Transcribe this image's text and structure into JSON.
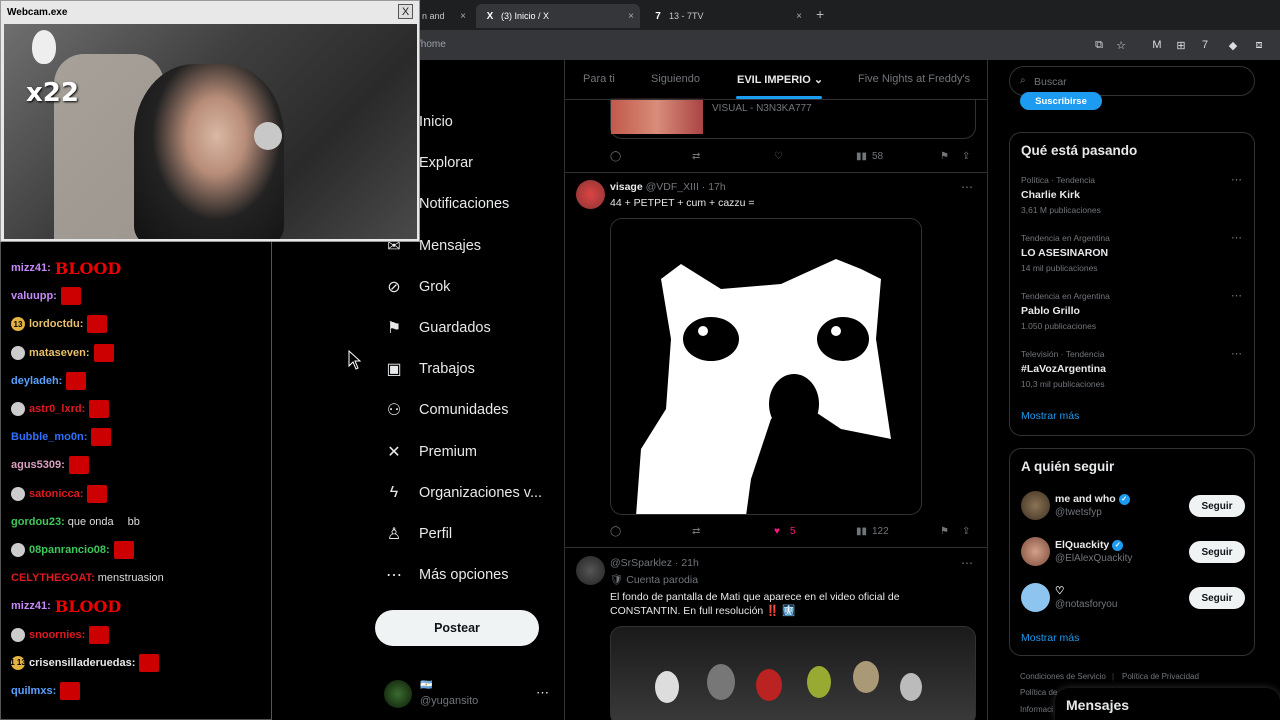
{
  "browser": {
    "tabs": [
      {
        "label": "n and",
        "fav": ""
      },
      {
        "label": "(3) Inicio / X",
        "fav": "X"
      },
      {
        "label": "13 - 7TV",
        "fav": "7"
      }
    ],
    "url": "/home",
    "new_tab": "+",
    "close": "×"
  },
  "webcam": {
    "title": "Webcam.exe",
    "close": "X",
    "overlay_text": "x22"
  },
  "chat": [
    {
      "user": "mizz41:",
      "color": "#c58af9",
      "msg": "",
      "emote": "BLOOD",
      "badge": ""
    },
    {
      "user": "valuupp:",
      "color": "#c58af9",
      "msg": "",
      "emote": "red",
      "badge": ""
    },
    {
      "user": "lordoctdu:",
      "color": "#e8c06a",
      "msg": "",
      "emote": "red",
      "badge": "13"
    },
    {
      "user": "mataseven:",
      "color": "#e8c06a",
      "msg": "",
      "emote": "red",
      "badge": "skull"
    },
    {
      "user": "deyladeh:",
      "color": "#5aa0ff",
      "msg": "",
      "emote": "red",
      "badge": ""
    },
    {
      "user": "astr0_lxrd:",
      "color": "#e0191f",
      "msg": "",
      "emote": "red",
      "badge": "skull"
    },
    {
      "user": "Bubble_mo0n:",
      "color": "#2f6fff",
      "msg": "",
      "emote": "red",
      "badge": ""
    },
    {
      "user": "agus5309:",
      "color": "#d9a0c0",
      "msg": "",
      "emote": "red",
      "badge": ""
    },
    {
      "user": "satonicca:",
      "color": "#e0191f",
      "msg": "",
      "emote": "red",
      "badge": "skull"
    },
    {
      "user": "gordou23:",
      "color": "#3dc85a",
      "msg": "que onda",
      "emote": "",
      "badge": "",
      "msg2": "bb"
    },
    {
      "user": "08panrancio08:",
      "color": "#3dc85a",
      "msg": "",
      "emote": "red",
      "badge": "skull"
    },
    {
      "user": "CELYTHEGOAT:",
      "color": "#e0191f",
      "msg": "menstruasion",
      "emote": "",
      "badge": ""
    },
    {
      "user": "mizz41:",
      "color": "#c58af9",
      "msg": "",
      "emote": "BLOOD",
      "badge": ""
    },
    {
      "user": "snoornies:",
      "color": "#e0191f",
      "msg": "",
      "emote": "red",
      "badge": "skull"
    },
    {
      "user": "crisensilladeruedas:",
      "color": "#e7e9ea",
      "msg": "",
      "emote": "red",
      "badge": "1 13"
    },
    {
      "user": "quilmxs:",
      "color": "#5aa0ff",
      "msg": "",
      "emote": "red",
      "badge": ""
    }
  ],
  "nav": {
    "items": [
      {
        "label": "Inicio",
        "icon": "home-icon",
        "glyph": "⌂"
      },
      {
        "label": "Explorar",
        "icon": "search-icon",
        "glyph": "⌕"
      },
      {
        "label": "Notificaciones",
        "icon": "bell-icon",
        "glyph": "🔔"
      },
      {
        "label": "Mensajes",
        "icon": "mail-icon",
        "glyph": "✉"
      },
      {
        "label": "Grok",
        "icon": "grok-icon",
        "glyph": "⊘"
      },
      {
        "label": "Guardados",
        "icon": "bookmark-icon",
        "glyph": "⚑"
      },
      {
        "label": "Trabajos",
        "icon": "briefcase-icon",
        "glyph": "▣"
      },
      {
        "label": "Comunidades",
        "icon": "communities-icon",
        "glyph": "⚇"
      },
      {
        "label": "Premium",
        "icon": "x-logo-icon",
        "glyph": "✕"
      },
      {
        "label": "Organizaciones v...",
        "icon": "lightning-icon",
        "glyph": "ϟ"
      },
      {
        "label": "Perfil",
        "icon": "person-icon",
        "glyph": "♙"
      },
      {
        "label": "Más opciones",
        "icon": "more-circle-icon",
        "glyph": "⋯"
      }
    ],
    "post_label": "Postear",
    "profile_handle": "@yugansito",
    "profile_flag": "🇦🇷"
  },
  "feed": {
    "tabs": [
      "Para ti",
      "Siguiendo",
      "EVIL IMPERIO",
      "Five Nights at Freddy's"
    ],
    "active_tab_arrow": "⌄",
    "prev_tweet": {
      "card_text": "VISUAL - N3N3KA777",
      "views": "58"
    },
    "tweet1": {
      "name": "visage",
      "meta": "@VDF_XIII · 17h",
      "text": "44 + PETPET + cum + cazzu =",
      "likes": "5",
      "views": "122"
    },
    "tweet2": {
      "meta": "@SrSparklez · 21h",
      "sub": "🛡 Cuenta parodia",
      "text": "El fondo de pantalla de Mati que aparece en el video oficial de CONSTANTIN. En full resolución ‼️ 🩻"
    }
  },
  "right": {
    "search_placeholder": "Buscar",
    "subscribe": "Suscribirse",
    "trends_title": "Qué está pasando",
    "trends": [
      {
        "cat": "Política · Tendencia",
        "name": "Charlie Kirk",
        "count": "3,61 M publicaciones"
      },
      {
        "cat": "Tendencia en Argentina",
        "name": "LO ASESINARON",
        "count": "14 mil publicaciones"
      },
      {
        "cat": "Tendencia en Argentina",
        "name": "Pablo Grillo",
        "count": "1.050 publicaciones"
      },
      {
        "cat": "Televisión · Tendencia",
        "name": "#LaVozArgentina",
        "count": "10,3 mil publicaciones"
      }
    ],
    "show_more": "Mostrar más",
    "follow_title": "A quién seguir",
    "follow": [
      {
        "name": "me and who",
        "handle": "@twetsfyp",
        "verified": true
      },
      {
        "name": "ElQuackity",
        "handle": "@ElAlexQuackity",
        "verified": true
      },
      {
        "name": "♡",
        "handle": "@notasforyou",
        "verified": false
      }
    ],
    "follow_label": "Seguir",
    "footer": [
      "Condiciones de Servicio",
      "Política de Privacidad",
      "Política de",
      "Informaci"
    ],
    "dm_label": "Mensajes"
  },
  "colors": {
    "accent": "#1d9bf0",
    "like": "#f91880",
    "chat_red": "#e0191f"
  }
}
